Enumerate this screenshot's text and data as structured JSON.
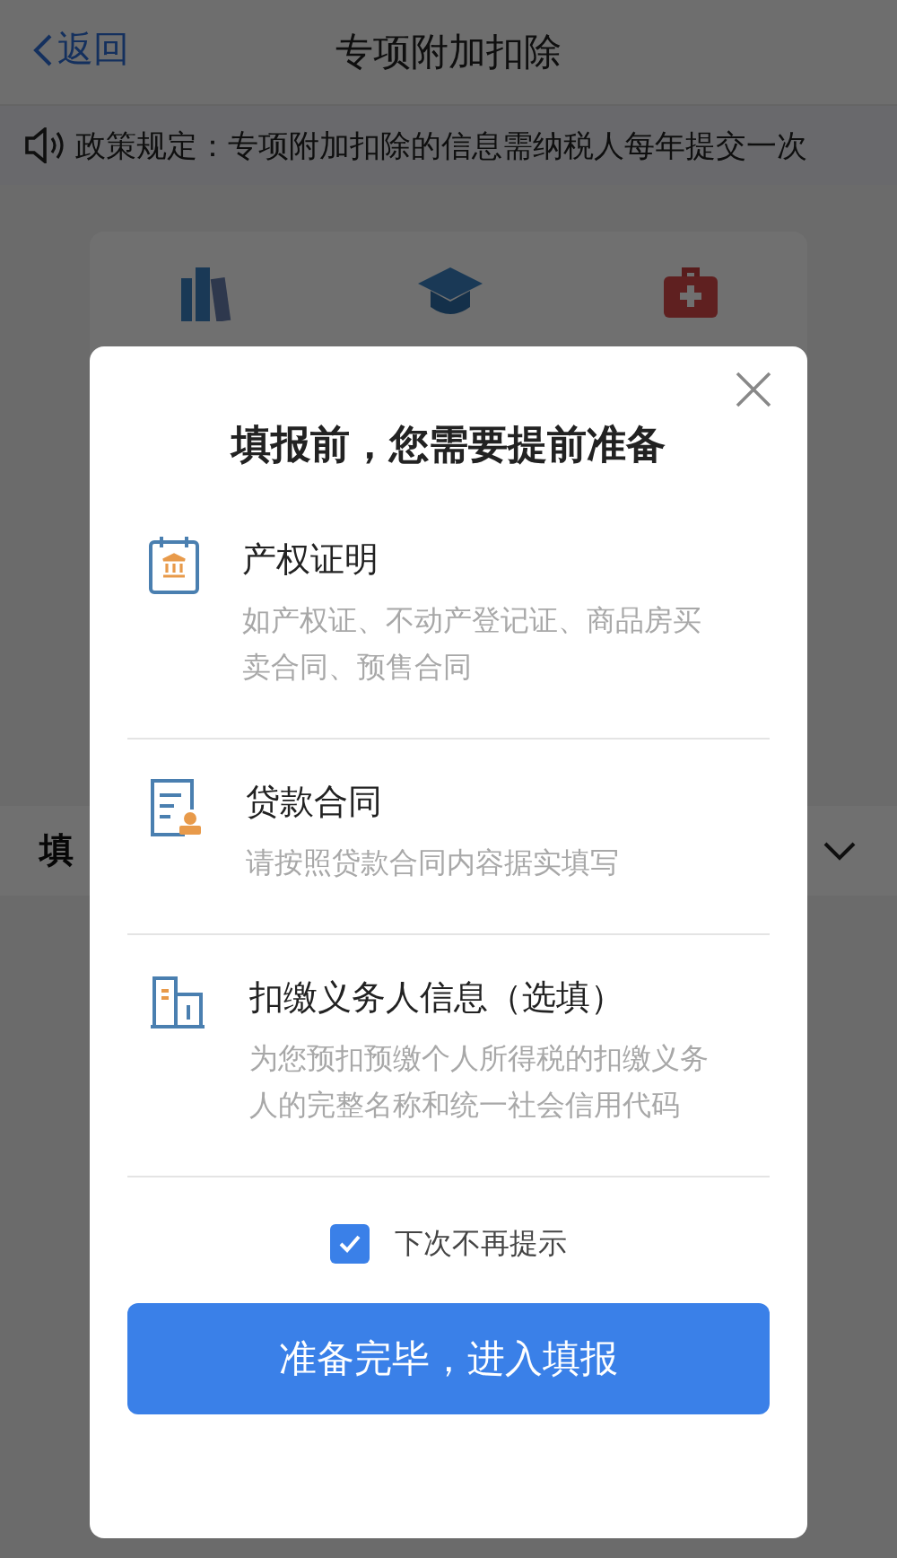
{
  "header": {
    "back": "返回",
    "title": "专项附加扣除"
  },
  "notice": {
    "text": "政策规定：专项附加扣除的信息需纳税人每年提交一次"
  },
  "category_icons": [
    {
      "kind": "books"
    },
    {
      "kind": "cap"
    },
    {
      "kind": "medkit"
    }
  ],
  "section": {
    "label": "填"
  },
  "dialog": {
    "title": "填报前，您需要提前准备",
    "items": [
      {
        "kind": "deed",
        "title": "产权证明",
        "description": "如产权证、不动产登记证、商品房买卖合同、预售合同"
      },
      {
        "kind": "contract",
        "title": "贷款合同",
        "description": "请按照贷款合同内容据实填写"
      },
      {
        "kind": "building",
        "title": "扣缴义务人信息（选填）",
        "description": "为您预扣预缴个人所得税的扣缴义务人的完整名称和统一社会信用代码"
      }
    ],
    "dont_remind": {
      "label": "下次不再提示",
      "checked": true
    },
    "confirm_button": "准备完毕，进入填报"
  }
}
